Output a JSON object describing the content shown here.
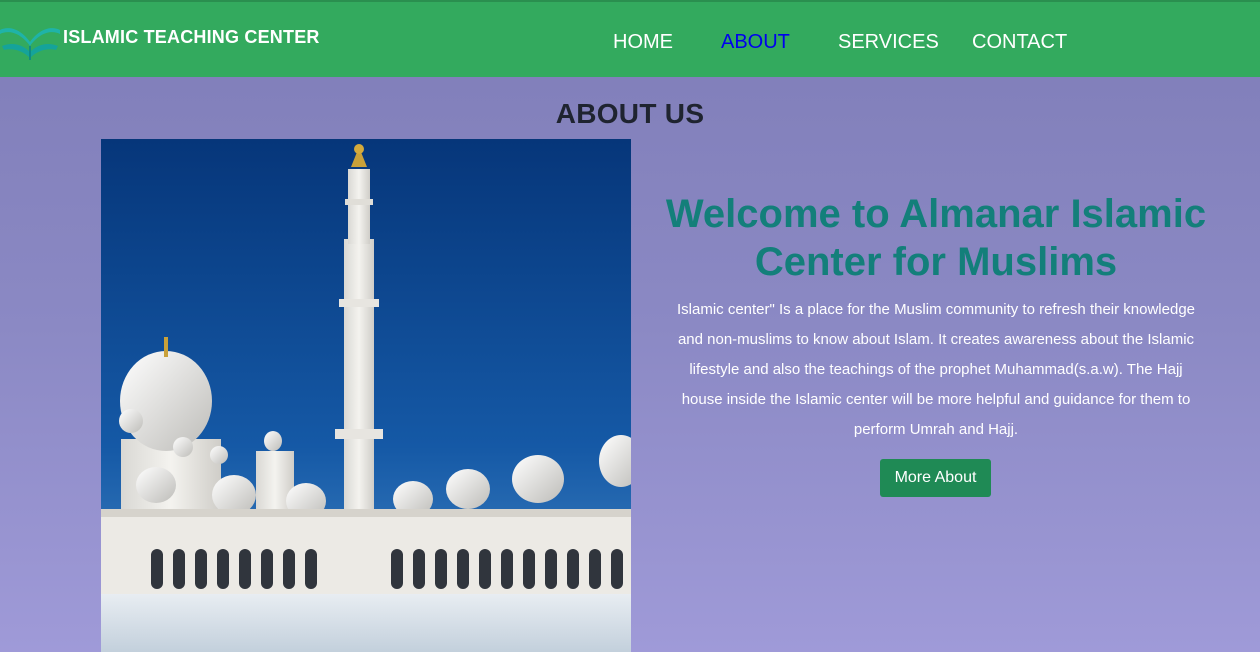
{
  "header": {
    "brand": "ISLAMIC TEACHING CENTER",
    "logo_icon": "quran-book-icon",
    "nav": [
      {
        "label": "HOME",
        "active": false
      },
      {
        "label": "ABOUT",
        "active": true
      },
      {
        "label": "SERVICES",
        "active": false
      },
      {
        "label": "CONTACT",
        "active": false
      }
    ]
  },
  "about": {
    "title": "ABOUT US",
    "image": "mosque-photo",
    "welcome": "Welcome to Almanar Islamic Center for Muslims",
    "description": "Islamic center\" Is a place for the Muslim community to refresh their knowledge and non-muslims to know about Islam. It creates awareness about the Islamic lifestyle and also the teachings of the prophet Muhammad(s.a.w). The Hajj house inside the Islamic center will be more helpful and guidance for them to perform Umrah and Hajj.",
    "button_label": "More About"
  },
  "colors": {
    "navbar": "#33aa5e",
    "active_link": "#0000ee",
    "welcome_text": "#137f7a",
    "button": "#1f8a55",
    "background_top": "#7f7db8",
    "background_bottom": "#9f9ad8"
  }
}
